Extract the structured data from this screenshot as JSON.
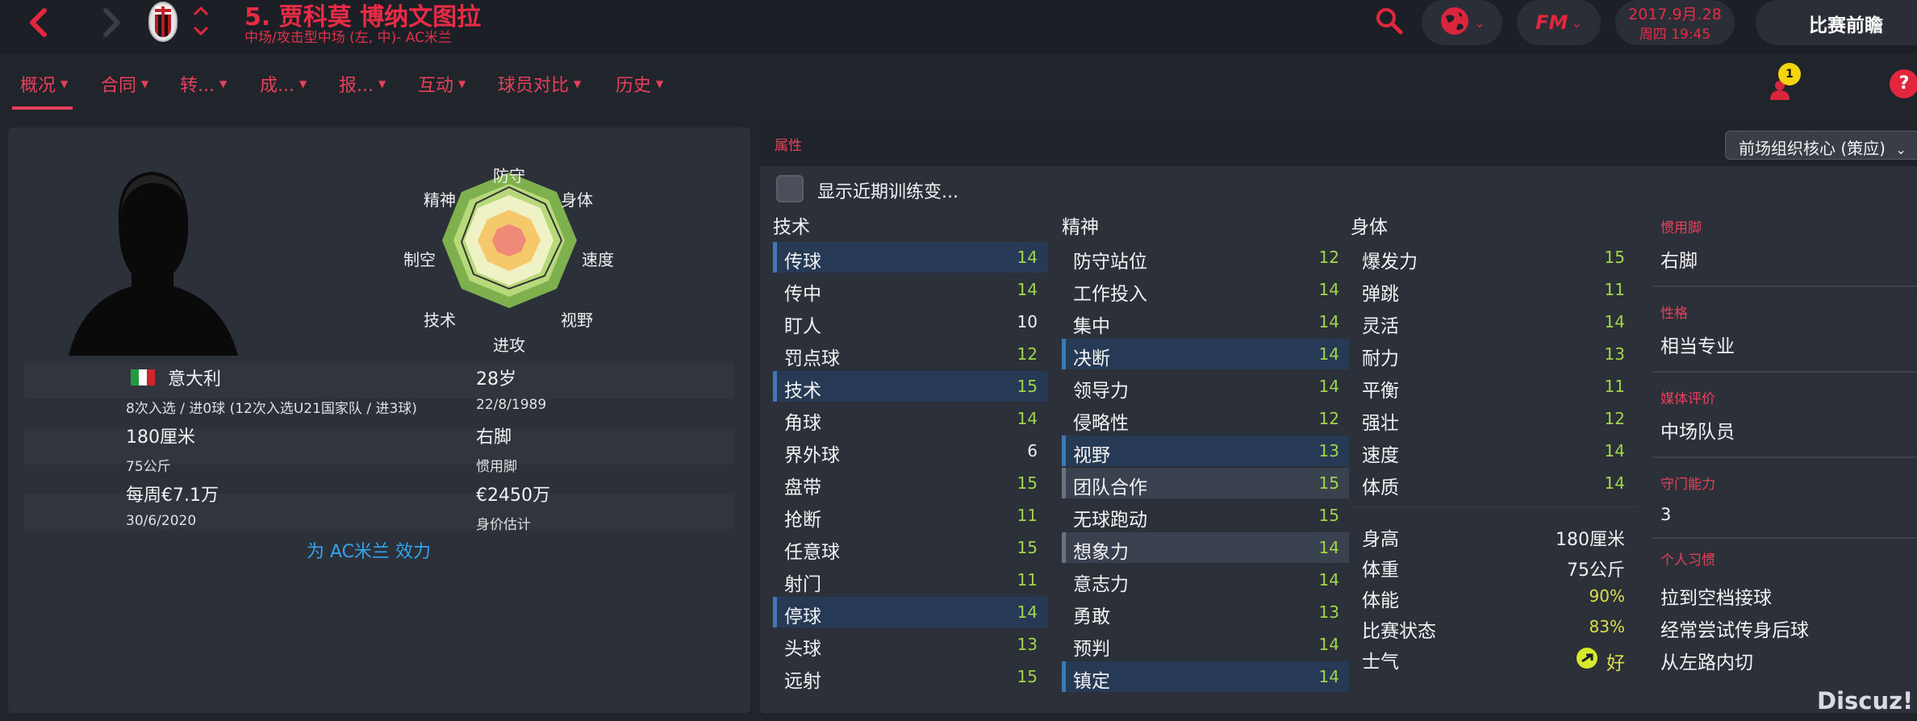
{
  "header": {
    "title": "5. 贾科莫 博纳文图拉",
    "subtitle": "中场/攻击型中场 (左, 中)- AC米兰",
    "date": "2017.9月.28",
    "day_time": "周四 19:45",
    "preview_button": "比赛前瞻",
    "fm_label": "FM"
  },
  "tabs": [
    {
      "label": "概况"
    },
    {
      "label": "合同"
    },
    {
      "label": "转..."
    },
    {
      "label": "成..."
    },
    {
      "label": "报..."
    },
    {
      "label": "互动"
    },
    {
      "label": "球员对比"
    },
    {
      "label": "历史"
    }
  ],
  "notifications": {
    "count": "1",
    "help": "?"
  },
  "radar": {
    "labels": {
      "defending": "防守",
      "physical": "身体",
      "speed": "速度",
      "vision": "视野",
      "attacking": "进攻",
      "technique": "技术",
      "aerial": "制空",
      "mental": "精神"
    }
  },
  "profile": {
    "nation": "意大利",
    "caps": "8次入选 / 进0球 (12次入选U21国家队 / 进3球)",
    "age": "28岁",
    "dob": "22/8/1989",
    "height": "180厘米",
    "weight": "75公斤",
    "foot": "右脚",
    "foot_label": "惯用脚",
    "wage": "每周€7.1万",
    "contract_end": "30/6/2020",
    "value": "€2450万",
    "value_label": "身价估计",
    "playing_for": "为 AC米兰 效力"
  },
  "attributes": {
    "section_title": "属性",
    "role": "前场组织核心 (策应)",
    "show_training": "显示近期训练变...",
    "technical_title": "技术",
    "mental_title": "精神",
    "physical_title": "身体",
    "technical": [
      {
        "name": "传球",
        "value": "14"
      },
      {
        "name": "传中",
        "value": "14"
      },
      {
        "name": "盯人",
        "value": "10"
      },
      {
        "name": "罚点球",
        "value": "12"
      },
      {
        "name": "技术",
        "value": "15"
      },
      {
        "name": "角球",
        "value": "14"
      },
      {
        "name": "界外球",
        "value": "6"
      },
      {
        "name": "盘带",
        "value": "15"
      },
      {
        "name": "抢断",
        "value": "11"
      },
      {
        "name": "任意球",
        "value": "15"
      },
      {
        "name": "射门",
        "value": "11"
      },
      {
        "name": "停球",
        "value": "14"
      },
      {
        "name": "头球",
        "value": "13"
      },
      {
        "name": "远射",
        "value": "15"
      }
    ],
    "mental": [
      {
        "name": "防守站位",
        "value": "12"
      },
      {
        "name": "工作投入",
        "value": "14"
      },
      {
        "name": "集中",
        "value": "14"
      },
      {
        "name": "决断",
        "value": "14"
      },
      {
        "name": "领导力",
        "value": "14"
      },
      {
        "name": "侵略性",
        "value": "12"
      },
      {
        "name": "视野",
        "value": "13"
      },
      {
        "name": "团队合作",
        "value": "15"
      },
      {
        "name": "无球跑动",
        "value": "15"
      },
      {
        "name": "想象力",
        "value": "14"
      },
      {
        "name": "意志力",
        "value": "14"
      },
      {
        "name": "勇敢",
        "value": "13"
      },
      {
        "name": "预判",
        "value": "14"
      },
      {
        "name": "镇定",
        "value": "14"
      }
    ],
    "physical": [
      {
        "name": "爆发力",
        "value": "15"
      },
      {
        "name": "弹跳",
        "value": "11"
      },
      {
        "name": "灵活",
        "value": "14"
      },
      {
        "name": "耐力",
        "value": "13"
      },
      {
        "name": "平衡",
        "value": "11"
      },
      {
        "name": "强壮",
        "value": "12"
      },
      {
        "name": "速度",
        "value": "14"
      },
      {
        "name": "体质",
        "value": "14"
      }
    ],
    "physical_info": [
      {
        "name": "身高",
        "value": "180厘米"
      },
      {
        "name": "体重",
        "value": "75公斤"
      },
      {
        "name": "体能",
        "value": "90%"
      },
      {
        "name": "比赛状态",
        "value": "83%"
      },
      {
        "name": "士气",
        "value": "好"
      }
    ]
  },
  "side": {
    "foot_label": "惯用脚",
    "foot_value": "右脚",
    "personality_label": "性格",
    "personality_value": "相当专业",
    "media_label": "媒体评价",
    "media_value": "中场队员",
    "gk_label": "守门能力",
    "gk_value": "3",
    "traits_label": "个人习惯",
    "traits": [
      "拉到空档接球",
      "经常尝试传身后球",
      "从左路内切"
    ]
  },
  "watermark": "Discuz!",
  "colors": {
    "accent": "#e8405a",
    "background": "#20242b",
    "panel": "#2c3039",
    "value_green": "#9fd64a",
    "highlight": "#263a55",
    "link_blue": "#35a4ef"
  }
}
